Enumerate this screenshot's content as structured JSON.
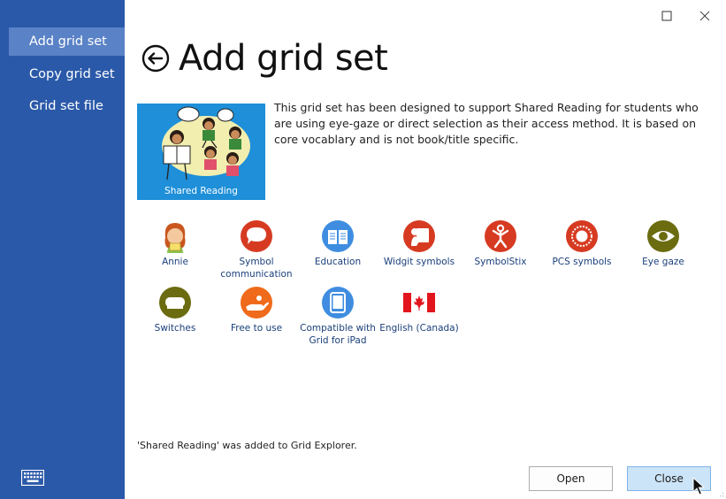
{
  "sidebar": {
    "items": [
      {
        "label": "Add grid set",
        "active": true
      },
      {
        "label": "Copy grid set",
        "active": false
      },
      {
        "label": "Grid set file",
        "active": false
      }
    ],
    "keyboard_icon": "keyboard-icon"
  },
  "window": {
    "maximize_icon": "maximize-icon",
    "close_icon": "close-icon"
  },
  "header": {
    "title": "Add grid set",
    "back_icon": "back-arrow-icon"
  },
  "gridset": {
    "thumbnail_caption": "Shared Reading",
    "description": "This grid set has been designed to support Shared Reading for students who are using eye-gaze or direct selection as their access method. It is based on core vocablary and is not book/title specific."
  },
  "badges": [
    {
      "label": "Annie",
      "icon": "annie-avatar-icon"
    },
    {
      "label": "Symbol communication",
      "icon": "speech-bubble-icon"
    },
    {
      "label": "Education",
      "icon": "book-icon"
    },
    {
      "label": "Widgit symbols",
      "icon": "widgit-icon"
    },
    {
      "label": "SymbolStix",
      "icon": "symbolstix-icon"
    },
    {
      "label": "PCS symbols",
      "icon": "pcs-icon"
    },
    {
      "label": "Eye gaze",
      "icon": "eye-icon"
    },
    {
      "label": "Switches",
      "icon": "switch-icon"
    },
    {
      "label": "Free to use",
      "icon": "free-hand-icon"
    },
    {
      "label": "Compatible with Grid for iPad",
      "icon": "ipad-icon"
    },
    {
      "label": "English (Canada)",
      "icon": "canada-flag-icon"
    }
  ],
  "colors": {
    "sidebar": "#2b59a9",
    "sidebar_active": "#5a82c6",
    "badge_red": "#d63b22",
    "badge_blue": "#3f8de0",
    "badge_olive": "#6b6b10",
    "badge_orange": "#ef6a1a"
  },
  "status": {
    "message": "'Shared Reading' was added to Grid Explorer."
  },
  "footer": {
    "open_label": "Open",
    "close_label": "Close"
  }
}
